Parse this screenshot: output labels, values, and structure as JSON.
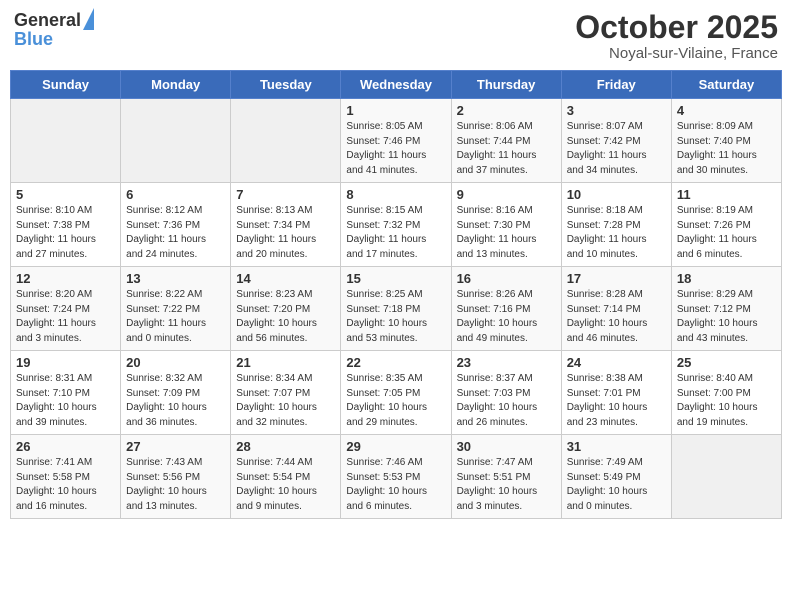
{
  "header": {
    "logo_general": "General",
    "logo_blue": "Blue",
    "month": "October 2025",
    "location": "Noyal-sur-Vilaine, France"
  },
  "days_of_week": [
    "Sunday",
    "Monday",
    "Tuesday",
    "Wednesday",
    "Thursday",
    "Friday",
    "Saturday"
  ],
  "weeks": [
    [
      {
        "day": "",
        "info": ""
      },
      {
        "day": "",
        "info": ""
      },
      {
        "day": "",
        "info": ""
      },
      {
        "day": "1",
        "info": "Sunrise: 8:05 AM\nSunset: 7:46 PM\nDaylight: 11 hours\nand 41 minutes."
      },
      {
        "day": "2",
        "info": "Sunrise: 8:06 AM\nSunset: 7:44 PM\nDaylight: 11 hours\nand 37 minutes."
      },
      {
        "day": "3",
        "info": "Sunrise: 8:07 AM\nSunset: 7:42 PM\nDaylight: 11 hours\nand 34 minutes."
      },
      {
        "day": "4",
        "info": "Sunrise: 8:09 AM\nSunset: 7:40 PM\nDaylight: 11 hours\nand 30 minutes."
      }
    ],
    [
      {
        "day": "5",
        "info": "Sunrise: 8:10 AM\nSunset: 7:38 PM\nDaylight: 11 hours\nand 27 minutes."
      },
      {
        "day": "6",
        "info": "Sunrise: 8:12 AM\nSunset: 7:36 PM\nDaylight: 11 hours\nand 24 minutes."
      },
      {
        "day": "7",
        "info": "Sunrise: 8:13 AM\nSunset: 7:34 PM\nDaylight: 11 hours\nand 20 minutes."
      },
      {
        "day": "8",
        "info": "Sunrise: 8:15 AM\nSunset: 7:32 PM\nDaylight: 11 hours\nand 17 minutes."
      },
      {
        "day": "9",
        "info": "Sunrise: 8:16 AM\nSunset: 7:30 PM\nDaylight: 11 hours\nand 13 minutes."
      },
      {
        "day": "10",
        "info": "Sunrise: 8:18 AM\nSunset: 7:28 PM\nDaylight: 11 hours\nand 10 minutes."
      },
      {
        "day": "11",
        "info": "Sunrise: 8:19 AM\nSunset: 7:26 PM\nDaylight: 11 hours\nand 6 minutes."
      }
    ],
    [
      {
        "day": "12",
        "info": "Sunrise: 8:20 AM\nSunset: 7:24 PM\nDaylight: 11 hours\nand 3 minutes."
      },
      {
        "day": "13",
        "info": "Sunrise: 8:22 AM\nSunset: 7:22 PM\nDaylight: 11 hours\nand 0 minutes."
      },
      {
        "day": "14",
        "info": "Sunrise: 8:23 AM\nSunset: 7:20 PM\nDaylight: 10 hours\nand 56 minutes."
      },
      {
        "day": "15",
        "info": "Sunrise: 8:25 AM\nSunset: 7:18 PM\nDaylight: 10 hours\nand 53 minutes."
      },
      {
        "day": "16",
        "info": "Sunrise: 8:26 AM\nSunset: 7:16 PM\nDaylight: 10 hours\nand 49 minutes."
      },
      {
        "day": "17",
        "info": "Sunrise: 8:28 AM\nSunset: 7:14 PM\nDaylight: 10 hours\nand 46 minutes."
      },
      {
        "day": "18",
        "info": "Sunrise: 8:29 AM\nSunset: 7:12 PM\nDaylight: 10 hours\nand 43 minutes."
      }
    ],
    [
      {
        "day": "19",
        "info": "Sunrise: 8:31 AM\nSunset: 7:10 PM\nDaylight: 10 hours\nand 39 minutes."
      },
      {
        "day": "20",
        "info": "Sunrise: 8:32 AM\nSunset: 7:09 PM\nDaylight: 10 hours\nand 36 minutes."
      },
      {
        "day": "21",
        "info": "Sunrise: 8:34 AM\nSunset: 7:07 PM\nDaylight: 10 hours\nand 32 minutes."
      },
      {
        "day": "22",
        "info": "Sunrise: 8:35 AM\nSunset: 7:05 PM\nDaylight: 10 hours\nand 29 minutes."
      },
      {
        "day": "23",
        "info": "Sunrise: 8:37 AM\nSunset: 7:03 PM\nDaylight: 10 hours\nand 26 minutes."
      },
      {
        "day": "24",
        "info": "Sunrise: 8:38 AM\nSunset: 7:01 PM\nDaylight: 10 hours\nand 23 minutes."
      },
      {
        "day": "25",
        "info": "Sunrise: 8:40 AM\nSunset: 7:00 PM\nDaylight: 10 hours\nand 19 minutes."
      }
    ],
    [
      {
        "day": "26",
        "info": "Sunrise: 7:41 AM\nSunset: 5:58 PM\nDaylight: 10 hours\nand 16 minutes."
      },
      {
        "day": "27",
        "info": "Sunrise: 7:43 AM\nSunset: 5:56 PM\nDaylight: 10 hours\nand 13 minutes."
      },
      {
        "day": "28",
        "info": "Sunrise: 7:44 AM\nSunset: 5:54 PM\nDaylight: 10 hours\nand 9 minutes."
      },
      {
        "day": "29",
        "info": "Sunrise: 7:46 AM\nSunset: 5:53 PM\nDaylight: 10 hours\nand 6 minutes."
      },
      {
        "day": "30",
        "info": "Sunrise: 7:47 AM\nSunset: 5:51 PM\nDaylight: 10 hours\nand 3 minutes."
      },
      {
        "day": "31",
        "info": "Sunrise: 7:49 AM\nSunset: 5:49 PM\nDaylight: 10 hours\nand 0 minutes."
      },
      {
        "day": "",
        "info": ""
      }
    ]
  ]
}
